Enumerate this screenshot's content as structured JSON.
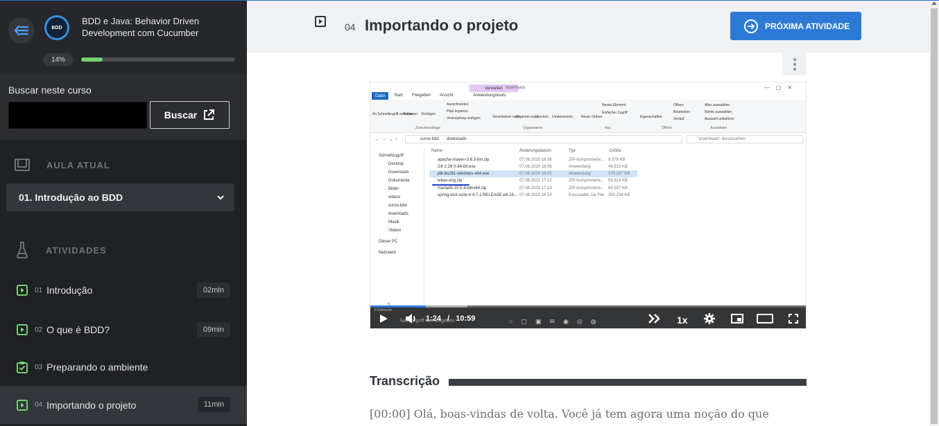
{
  "course": {
    "title": "BDD e Java: Behavior Driven Development com Cucumber",
    "logo_text": "BDD",
    "progress_label": "14%",
    "progress": 0.14
  },
  "search": {
    "label": "Buscar neste curso",
    "placeholder": "",
    "button_label": "Buscar"
  },
  "sidebar": {
    "current_lesson_label": "AULA ATUAL",
    "current_lesson": "01. Introdução ao BDD",
    "activities_label": "ATIVIDADES",
    "activities": [
      {
        "num": "01",
        "title": "Introdução",
        "duration": "02min",
        "type": "video"
      },
      {
        "num": "02",
        "title": "O que é BDD?",
        "duration": "09min",
        "type": "video"
      },
      {
        "num": "03",
        "title": "Preparando o ambiente",
        "duration": "",
        "type": "task"
      },
      {
        "num": "04",
        "title": "Importando o projeto",
        "duration": "11min",
        "type": "video"
      }
    ]
  },
  "header": {
    "lesson_num": "04",
    "lesson_title": "Importando o projeto",
    "next_button": "PRÓXIMA ATIVIDADE"
  },
  "video": {
    "current_time": "1:24",
    "separator": "/",
    "duration": "10:59",
    "progress": 0.1275,
    "speed": "1x",
    "explorer": {
      "tabs": [
        "Datei",
        "Start",
        "Freigeben",
        "Ansicht",
        "Anwendungstools"
      ],
      "context_tab": "Verwalten",
      "window_title": "downloads",
      "ribbon_items": [
        "An Schnellzugriff anheften",
        "Kopieren",
        "Einfügen",
        "Ausschneiden",
        "Pfad kopieren",
        "Verknüpfung einfügen",
        "Verschieben nach",
        "Kopieren nach",
        "Löschen",
        "Umbenennen",
        "Neuer Ordner",
        "Neues Element",
        "Einfacher Zugriff",
        "Eigenschaften",
        "Öffnen",
        "Bearbeiten",
        "Verlauf",
        "Alles auswählen",
        "Nichts auswählen",
        "Auswahl umkehren"
      ],
      "ribbon_groups": [
        "Zwischenablage",
        "Organisieren",
        "Neu",
        "Öffnen",
        "Auswählen"
      ],
      "path": [
        "curso-bdd",
        "downloads"
      ],
      "search_placeholder": "\"downloads\" durchsuchen",
      "nav": [
        "Schnellzugriff",
        "Desktop",
        "Downloads",
        "Dokumente",
        "Bilder",
        "videos",
        "curso-bdd",
        "downloads",
        "Musik",
        "Videos",
        "Dieser PC",
        "Netzwerk"
      ],
      "columns": [
        "Name",
        "Änderungsdatum",
        "Typ",
        "Größe"
      ],
      "files": [
        {
          "name": "apache-maven-3.6.3-bin.zip",
          "date": "07.08.2020 16:06",
          "type": "ZIP-komprimierte...",
          "size": "9.378 KB"
        },
        {
          "name": "Git-2.28.0-64-bit.exe",
          "date": "07.08.2020 16:06",
          "type": "Anwendung",
          "size": "49.913 KB"
        },
        {
          "name": "jdk-8u261-windows-x64.exe",
          "date": "07.08.2020 16:02",
          "type": "Anwendung",
          "size": "170.267 KB"
        },
        {
          "name": "leilao-orig.zip",
          "date": "07.08.2020 17:15",
          "type": "ZIP-komprimierte...",
          "size": "56.824 KB"
        },
        {
          "name": "mariadb-10.5.4-winx64.zip",
          "date": "07.08.2020 17:23",
          "type": "ZIP-komprimierte...",
          "size": "69.507 KB"
        },
        {
          "name": "spring-tool-suite-4-4.7.1.RELEASE-e4.16....",
          "date": "07.08.2020 16:14",
          "type": "Executable Jar File",
          "size": "390.236 KB"
        }
      ],
      "status": "6 Elemente",
      "taskbar_search": "Suchbegriff hier eingeben"
    }
  },
  "transcript": {
    "title": "Transcrição",
    "text": "[00:00] Olá, boas-vindas de volta. Você já tem agora uma noção do que"
  },
  "colors": {
    "accent": "#2c7ad6",
    "progress_green": "#74d06f",
    "sidebar_bg": "#2b2d31",
    "sidebar_dark": "#1f2125"
  }
}
